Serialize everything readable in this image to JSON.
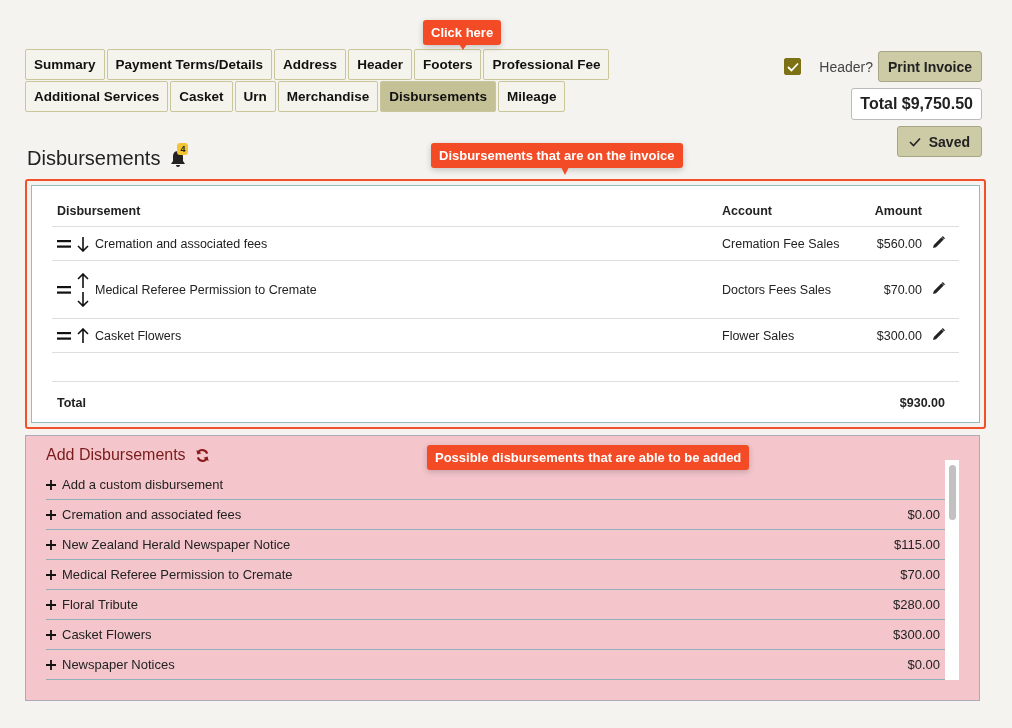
{
  "tabs": [
    [
      {
        "label": "Summary",
        "selected": false
      },
      {
        "label": "Payment Terms/Details",
        "selected": false
      },
      {
        "label": "Address",
        "selected": false
      },
      {
        "label": "Header",
        "selected": false
      },
      {
        "label": "Footers",
        "selected": false
      },
      {
        "label": "Professional Fee",
        "selected": false
      }
    ],
    [
      {
        "label": "Additional Services",
        "selected": false
      },
      {
        "label": "Casket",
        "selected": false
      },
      {
        "label": "Urn",
        "selected": false
      },
      {
        "label": "Merchandise",
        "selected": false
      },
      {
        "label": "Disbursements",
        "selected": true
      },
      {
        "label": "Mileage",
        "selected": false
      }
    ]
  ],
  "header_option": {
    "label": "Header?",
    "checked": true
  },
  "print_button": "Print Invoice",
  "total_badge": "Total $9,750.50",
  "saved_button": "Saved",
  "section_title": "Disbursements",
  "notification_count": "4",
  "callouts": [
    {
      "text": "Click here"
    },
    {
      "text": "Disbursements that are on the invoice"
    },
    {
      "text": "Possible disbursements that are able to be added"
    }
  ],
  "invoice_table": {
    "columns": [
      "Disbursement",
      "Account",
      "Amount"
    ],
    "rows": [
      {
        "kind": "down",
        "name": "Cremation and associated fees",
        "account": "Cremation Fee Sales",
        "amount": "$560.00"
      },
      {
        "kind": "both",
        "name": "Medical Referee Permission to Cremate",
        "account": "Doctors Fees Sales",
        "amount": "$70.00"
      },
      {
        "kind": "up",
        "name": "Casket Flowers",
        "account": "Flower Sales",
        "amount": "$300.00"
      }
    ],
    "total_label": "Total",
    "total": "$930.00"
  },
  "add_panel": {
    "title": "Add Disbursements",
    "items": [
      {
        "name": "Add a custom disbursement"
      },
      {
        "name": "Cremation and associated fees",
        "amount": "$0.00"
      },
      {
        "name": "New Zealand Herald Newspaper Notice",
        "amount": "$115.00"
      },
      {
        "name": "Medical Referee Permission to Cremate",
        "amount": "$70.00"
      },
      {
        "name": "Floral Tribute",
        "amount": "$280.00"
      },
      {
        "name": "Casket Flowers",
        "amount": "$300.00"
      },
      {
        "name": "Newspaper Notices",
        "amount": "$0.00"
      }
    ]
  }
}
